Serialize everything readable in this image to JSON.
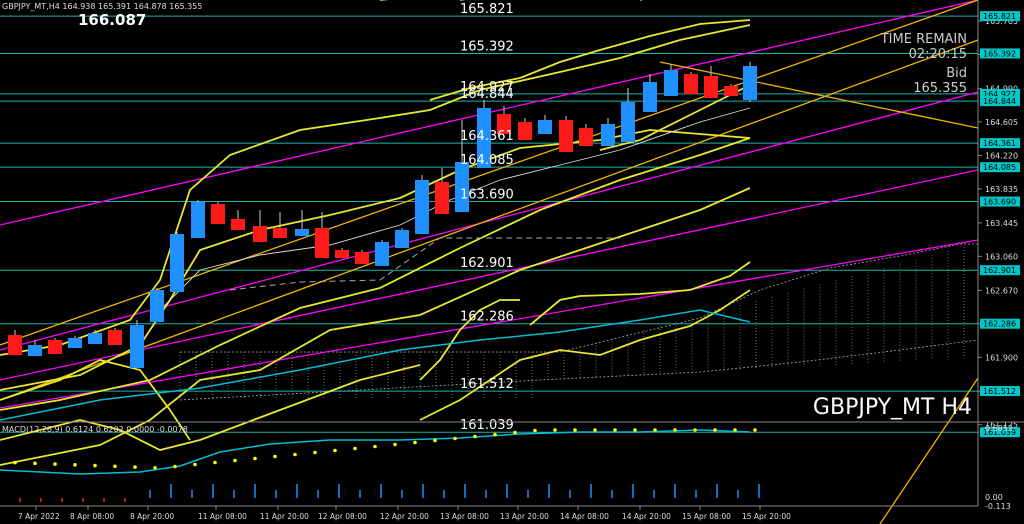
{
  "header": {
    "symbol_line": "GBPJPY_MT,H4  164.938 165.391 164.878 165.355",
    "bid_price": "166.087"
  },
  "hud": {
    "time_remain_label": "TIME REMAIN",
    "time_remain": "02:20:15",
    "bid_label": "Bid",
    "bid_value": "165.355"
  },
  "watermark": "GBPJPY_MT H4",
  "level_labels": [
    "165.821",
    "165.392",
    "164.927",
    "164.844",
    "164.361",
    "164.085",
    "163.690",
    "162.901",
    "162.286",
    "161.512",
    "161.039"
  ],
  "price_scale": {
    "ticks": [
      "165.765",
      "165.380",
      "164.990",
      "164.605",
      "164.220",
      "163.835",
      "163.445",
      "163.060",
      "162.670",
      "162.285",
      "161.900",
      "161.510",
      "161.125"
    ],
    "tags": [
      "165.821",
      "165.392",
      "164.927",
      "164.844",
      "164.361",
      "164.085",
      "163.690",
      "162.901",
      "162.286",
      "161.512",
      "161.039"
    ]
  },
  "macd": {
    "label": "MACD(12,26,9)  0.6124  0.6202  0.0000  -0.0078",
    "scale": [
      "0.6852",
      "0.00",
      "-0.113"
    ]
  },
  "time_axis": [
    "7 Apr 2022",
    "8 Apr 08:00",
    "8 Apr 20:00",
    "11 Apr 08:00",
    "11 Apr 20:00",
    "12 Apr 08:00",
    "12 Apr 20:00",
    "13 Apr 08:00",
    "13 Apr 20:00",
    "14 Apr 08:00",
    "14 Apr 20:00",
    "15 Apr 08:00",
    "15 Apr 20:00"
  ],
  "colors": {
    "bull": "#1e90ff",
    "bear": "#ff1a1a",
    "levels": "#20b2aa",
    "channel": "#ff00ff",
    "bands": "#e8e830",
    "macd": "#00bcd4",
    "signal": "#ffff00",
    "tag_bg": "#00c8c8"
  }
}
